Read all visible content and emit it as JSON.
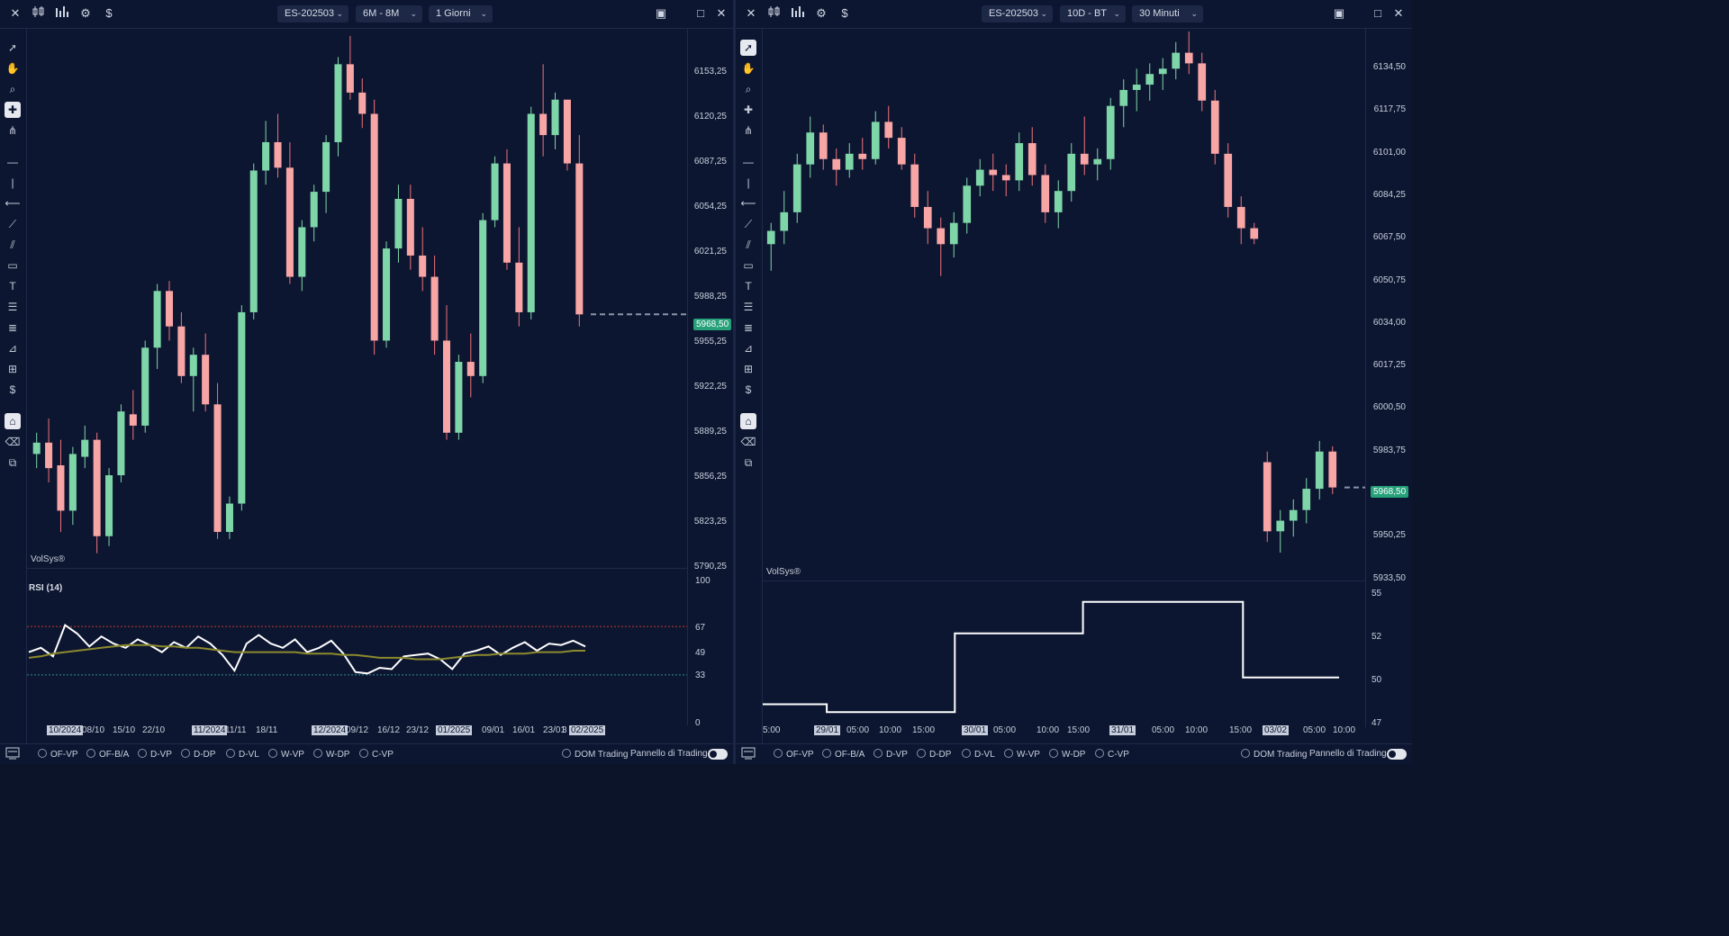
{
  "left": {
    "toolbar": {
      "close": "✕",
      "symbol": "ES-202503",
      "period": "6M - 8M",
      "timeframe": "1 Giorni"
    },
    "yticks": [
      "6153,25",
      "6120,25",
      "6087,25",
      "6054,25",
      "6021,25",
      "5988,25",
      "5955,25",
      "5922,25",
      "5889,25",
      "5856,25",
      "5823,25",
      "5790,25"
    ],
    "price_tag": "5968,50",
    "brand": "VolSys®",
    "rsi_title": "RSI (14)",
    "rsi_ticks": [
      "100",
      "67",
      "49",
      "33",
      "0"
    ],
    "xticks": [
      {
        "t": "10/2024",
        "hl": true
      },
      {
        "t": "08/10",
        "hl": false
      },
      {
        "t": "15/10",
        "hl": false
      },
      {
        "t": "22/10",
        "hl": false
      },
      {
        "t": "11/2024",
        "hl": true
      },
      {
        "t": "11/11",
        "hl": false
      },
      {
        "t": "18/11",
        "hl": false
      },
      {
        "t": "12/2024",
        "hl": true
      },
      {
        "t": "09/12",
        "hl": false
      },
      {
        "t": "16/12",
        "hl": false
      },
      {
        "t": "23/12",
        "hl": false
      },
      {
        "t": "01/2025",
        "hl": true
      },
      {
        "t": "09/01",
        "hl": false
      },
      {
        "t": "16/01",
        "hl": false
      },
      {
        "t": "23/01",
        "hl": false
      },
      {
        "t": "3",
        "hl": false
      },
      {
        "t": "02/2025",
        "hl": true
      }
    ],
    "options": [
      "OF-VP",
      "OF-B/A",
      "D-VP",
      "D-DP",
      "D-VL",
      "W-VP",
      "W-DP",
      "C-VP"
    ],
    "dom": "DOM Trading",
    "panel": "Pannello di Trading"
  },
  "right": {
    "toolbar": {
      "close": "✕",
      "symbol": "ES-202503",
      "period": "10D - BT",
      "timeframe": "30 Minuti"
    },
    "yticks": [
      "6134,50",
      "6117,75",
      "6101,00",
      "6084,25",
      "6067,50",
      "6050,75",
      "6034,00",
      "6017,25",
      "6000,50",
      "5983,75",
      "5967,00",
      "5950,25",
      "5933,50"
    ],
    "price_tag": "5968,50",
    "brand": "VolSys®",
    "sub_ticks": [
      "55",
      "52",
      "50",
      "47"
    ],
    "xticks": [
      {
        "t": "5:00",
        "hl": false
      },
      {
        "t": "29/01",
        "hl": true
      },
      {
        "t": "05:00",
        "hl": false
      },
      {
        "t": "10:00",
        "hl": false
      },
      {
        "t": "15:00",
        "hl": false
      },
      {
        "t": "30/01",
        "hl": true
      },
      {
        "t": "05:00",
        "hl": false
      },
      {
        "t": "10:00",
        "hl": false
      },
      {
        "t": "15:00",
        "hl": false
      },
      {
        "t": "31/01",
        "hl": true
      },
      {
        "t": "05:00",
        "hl": false
      },
      {
        "t": "10:00",
        "hl": false
      },
      {
        "t": "15:00",
        "hl": false
      },
      {
        "t": "03/02",
        "hl": true
      },
      {
        "t": "05:00",
        "hl": false
      },
      {
        "t": "10:00",
        "hl": false
      }
    ],
    "options": [
      "OF-VP",
      "OF-B/A",
      "D-VP",
      "D-DP",
      "D-VL",
      "W-VP",
      "W-DP",
      "C-VP"
    ],
    "dom": "DOM Trading",
    "panel": "Pannello di Trading"
  },
  "colors": {
    "bull": "#7ed6a8",
    "bear": "#f0737a",
    "bear_fill": "#f8a5a5",
    "bg": "#0d1631",
    "rsi": "#ffffff",
    "rsi_ma": "#8c8a2c",
    "ob": "#c0392b",
    "os": "#2f8f8f",
    "tag": "#26a17a"
  },
  "tool_icons": [
    "pointer-icon",
    "hand-icon",
    "zoom-icon",
    "crosshair-icon",
    "magnet-icon",
    "hline-icon",
    "vline-icon",
    "ray-icon",
    "trendline-icon",
    "channel-icon",
    "rectangle-icon",
    "text-icon",
    "fib-icon",
    "lines-icon",
    "ruler-icon",
    "measure-icon",
    "order-icon",
    "lock-icon",
    "eraser-icon",
    "layers-icon"
  ],
  "chart_data": [
    {
      "type": "candlestick",
      "title": "",
      "ylim": [
        5790.25,
        6170
      ],
      "price_line": 5968.5,
      "candles": [
        [
          5870,
          5885,
          5860,
          5878
        ],
        [
          5878,
          5895,
          5850,
          5860
        ],
        [
          5862,
          5880,
          5815,
          5830
        ],
        [
          5830,
          5875,
          5820,
          5870
        ],
        [
          5868,
          5890,
          5860,
          5880
        ],
        [
          5880,
          5885,
          5800,
          5812
        ],
        [
          5812,
          5860,
          5805,
          5855
        ],
        [
          5855,
          5905,
          5850,
          5900
        ],
        [
          5898,
          5915,
          5880,
          5890
        ],
        [
          5890,
          5950,
          5885,
          5945
        ],
        [
          5945,
          5990,
          5930,
          5985
        ],
        [
          5985,
          5992,
          5950,
          5960
        ],
        [
          5960,
          5970,
          5920,
          5925
        ],
        [
          5925,
          5945,
          5900,
          5940
        ],
        [
          5940,
          5955,
          5900,
          5905
        ],
        [
          5905,
          5920,
          5810,
          5815
        ],
        [
          5815,
          5840,
          5810,
          5835
        ],
        [
          5835,
          5975,
          5830,
          5970
        ],
        [
          5970,
          6075,
          5965,
          6070
        ],
        [
          6070,
          6105,
          6060,
          6090
        ],
        [
          6090,
          6110,
          6065,
          6072
        ],
        [
          6072,
          6090,
          5990,
          5995
        ],
        [
          5995,
          6035,
          5985,
          6030
        ],
        [
          6030,
          6060,
          6020,
          6055
        ],
        [
          6055,
          6095,
          6040,
          6090
        ],
        [
          6090,
          6150,
          6080,
          6145
        ],
        [
          6145,
          6165,
          6120,
          6125
        ],
        [
          6125,
          6135,
          6100,
          6110
        ],
        [
          6110,
          6120,
          5940,
          5950
        ],
        [
          5950,
          6020,
          5945,
          6015
        ],
        [
          6015,
          6060,
          6005,
          6050
        ],
        [
          6050,
          6060,
          6000,
          6010
        ],
        [
          6010,
          6030,
          5985,
          5995
        ],
        [
          5995,
          6010,
          5940,
          5950
        ],
        [
          5950,
          5975,
          5880,
          5885
        ],
        [
          5885,
          5940,
          5880,
          5935
        ],
        [
          5935,
          5955,
          5910,
          5925
        ],
        [
          5925,
          6040,
          5920,
          6035
        ],
        [
          6035,
          6080,
          6030,
          6075
        ],
        [
          6075,
          6085,
          6000,
          6005
        ],
        [
          6005,
          6030,
          5960,
          5970
        ],
        [
          5970,
          6115,
          5965,
          6110
        ],
        [
          6110,
          6145,
          6080,
          6095
        ],
        [
          6095,
          6125,
          6085,
          6120
        ],
        [
          6120,
          6120,
          6070,
          6075
        ],
        [
          6075,
          6095,
          5960,
          5968.5
        ]
      ]
    },
    {
      "type": "line",
      "title": "RSI (14)",
      "ylim": [
        0,
        100
      ],
      "overbought": 67,
      "oversold": 33,
      "series": [
        {
          "name": "RSI (14)",
          "values": [
            49,
            52,
            46,
            68,
            62,
            53,
            60,
            55,
            52,
            58,
            54,
            49,
            56,
            52,
            60,
            55,
            47,
            36,
            55,
            61,
            55,
            52,
            58,
            49,
            52,
            57,
            48,
            35,
            34,
            38,
            37,
            46,
            47,
            48,
            44,
            37,
            48,
            50,
            53,
            47,
            52,
            56,
            50,
            55,
            54,
            57,
            53
          ]
        },
        {
          "name": "",
          "values": [
            45,
            46,
            48,
            49,
            50,
            51,
            52,
            53,
            54,
            54,
            54,
            53,
            53,
            52,
            52,
            51,
            50,
            49,
            49,
            49,
            49,
            49,
            49,
            48,
            48,
            48,
            47,
            47,
            46,
            45,
            45,
            45,
            44,
            44,
            44,
            45,
            46,
            47,
            47,
            48,
            48,
            48,
            49,
            49,
            49,
            50,
            50
          ]
        }
      ]
    },
    {
      "type": "candlestick",
      "title": "",
      "ylim": [
        5933.5,
        6141
      ],
      "price_line": 5968.5,
      "candles": [
        [
          6060,
          6068,
          6050,
          6065
        ],
        [
          6065,
          6080,
          6060,
          6072
        ],
        [
          6072,
          6094,
          6068,
          6090
        ],
        [
          6090,
          6108,
          6085,
          6102
        ],
        [
          6102,
          6105,
          6088,
          6092
        ],
        [
          6092,
          6096,
          6082,
          6088
        ],
        [
          6088,
          6098,
          6085,
          6094
        ],
        [
          6094,
          6100,
          6088,
          6092
        ],
        [
          6092,
          6110,
          6090,
          6106
        ],
        [
          6106,
          6112,
          6096,
          6100
        ],
        [
          6100,
          6104,
          6088,
          6090
        ],
        [
          6090,
          6094,
          6070,
          6074
        ],
        [
          6074,
          6080,
          6060,
          6066
        ],
        [
          6066,
          6070,
          6048,
          6060
        ],
        [
          6060,
          6072,
          6055,
          6068
        ],
        [
          6068,
          6085,
          6064,
          6082
        ],
        [
          6082,
          6092,
          6078,
          6088
        ],
        [
          6088,
          6094,
          6080,
          6086
        ],
        [
          6086,
          6090,
          6078,
          6084
        ],
        [
          6084,
          6102,
          6080,
          6098
        ],
        [
          6098,
          6104,
          6082,
          6086
        ],
        [
          6086,
          6090,
          6068,
          6072
        ],
        [
          6072,
          6084,
          6066,
          6080
        ],
        [
          6080,
          6098,
          6076,
          6094
        ],
        [
          6094,
          6108,
          6086,
          6090
        ],
        [
          6090,
          6096,
          6084,
          6092
        ],
        [
          6092,
          6115,
          6088,
          6112
        ],
        [
          6112,
          6122,
          6104,
          6118
        ],
        [
          6118,
          6126,
          6110,
          6120
        ],
        [
          6120,
          6128,
          6114,
          6124
        ],
        [
          6124,
          6130,
          6118,
          6126
        ],
        [
          6126,
          6136,
          6122,
          6132
        ],
        [
          6132,
          6140,
          6124,
          6128
        ],
        [
          6128,
          6132,
          6110,
          6114
        ],
        [
          6114,
          6118,
          6090,
          6094
        ],
        [
          6094,
          6098,
          6070,
          6074
        ],
        [
          6074,
          6078,
          6060,
          6066
        ],
        [
          6066,
          6068,
          6060,
          6062
        ],
        [
          5978,
          5982,
          5948,
          5952
        ],
        [
          5952,
          5960,
          5944,
          5956
        ],
        [
          5956,
          5964,
          5950,
          5960
        ],
        [
          5960,
          5972,
          5955,
          5968
        ],
        [
          5968,
          5986,
          5964,
          5982
        ],
        [
          5982,
          5984,
          5966,
          5968.5
        ]
      ]
    },
    {
      "type": "line",
      "title": "",
      "ylim": [
        47,
        55
      ],
      "series": [
        {
          "name": "",
          "values": [
            48,
            48,
            47.5,
            47.5,
            47.5,
            47.5,
            52.5,
            52.5,
            52.5,
            52.5,
            54.5,
            54.5,
            54.5,
            54.5,
            54.5,
            49.7,
            49.7,
            49.7
          ]
        }
      ]
    }
  ]
}
